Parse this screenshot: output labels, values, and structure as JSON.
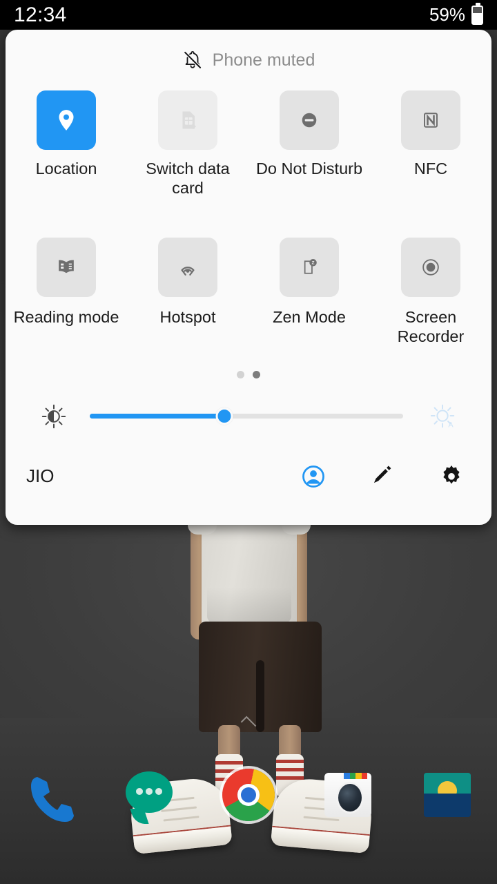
{
  "statusbar": {
    "time": "12:34",
    "battery_percent": "59%",
    "battery_level": 59,
    "battery_icon": "battery-icon",
    "background": "#000000"
  },
  "panel": {
    "background": "#fafafa",
    "status_row": {
      "icon": "bell-muted-icon",
      "text": "Phone muted",
      "text_color": "#8c8c8c"
    },
    "accent_color": "#2196f3",
    "tile_off_color": "#e3e3e3",
    "tiles": [
      {
        "label": "Location",
        "icon": "location-pin-icon",
        "state": "on"
      },
      {
        "label": "Switch data card",
        "icon": "sim-card-icon",
        "state": "disabled"
      },
      {
        "label": "Do Not Disturb",
        "icon": "do-not-disturb-icon",
        "state": "off"
      },
      {
        "label": "NFC",
        "icon": "nfc-icon",
        "state": "off"
      },
      {
        "label": "Reading mode",
        "icon": "open-book-icon",
        "state": "off"
      },
      {
        "label": "Hotspot",
        "icon": "hotspot-icon",
        "state": "off"
      },
      {
        "label": "Zen Mode",
        "icon": "zen-mode-icon",
        "state": "off"
      },
      {
        "label": "Screen Recorder",
        "icon": "screen-recorder-icon",
        "state": "off"
      }
    ],
    "pager": {
      "pages": 2,
      "active_page": 2
    },
    "brightness": {
      "left_icon": "brightness-medium-icon",
      "right_icon": "auto-brightness-icon",
      "value_percent": 43
    },
    "footer": {
      "carrier": "JIO",
      "actions": [
        {
          "name": "account-icon",
          "color": "#2196f3"
        },
        {
          "name": "edit-icon",
          "color": "#141414"
        },
        {
          "name": "settings-icon",
          "color": "#141414"
        }
      ]
    }
  },
  "homescreen": {
    "wallpaper_color": "#383838",
    "home_indicator": "home-chevron-icon",
    "dock": [
      {
        "name": "phone-app-icon",
        "label": "Phone",
        "color": "#1878d0"
      },
      {
        "name": "messages-app-icon",
        "label": "Messages",
        "color": "#00a082"
      },
      {
        "name": "chrome-app-icon",
        "label": "Chrome",
        "color": "#2a6fd4"
      },
      {
        "name": "camera-app-icon",
        "label": "Camera",
        "color": "#ffffff"
      },
      {
        "name": "gallery-app-icon",
        "label": "Gallery",
        "color": "#0d3a6b"
      }
    ]
  }
}
